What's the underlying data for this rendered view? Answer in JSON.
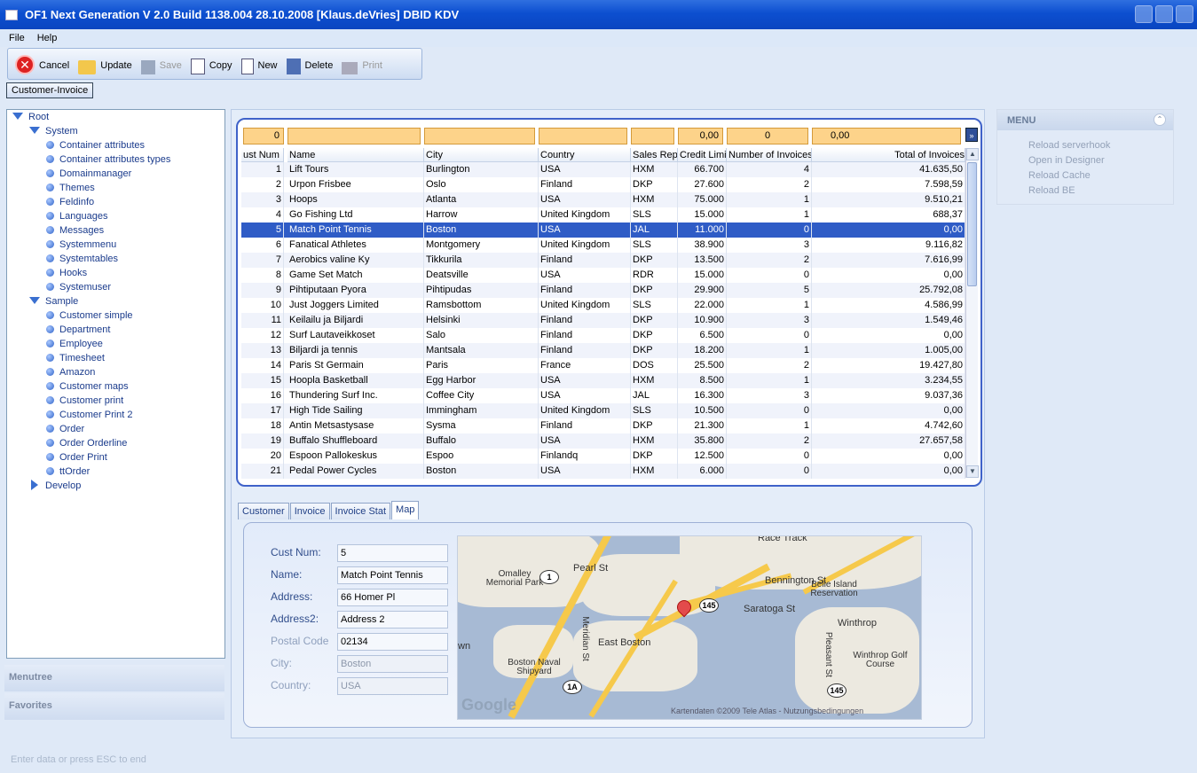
{
  "window": {
    "title": "OF1 Next Generation   V 2.0 Build 1138.004  28.10.2008   [Klaus.deVries]   DBID KDV"
  },
  "menubar": {
    "file": "File",
    "help": "Help"
  },
  "toolbar": {
    "cancel": "Cancel",
    "update": "Update",
    "save": "Save",
    "copy": "Copy",
    "new": "New",
    "delete": "Delete",
    "print": "Print"
  },
  "breadcrumb_tab": "Customer-Invoice",
  "tree": {
    "root": "Root",
    "system": "System",
    "system_items": [
      "Container attributes",
      "Container attributes types",
      "Domainmanager",
      "Themes",
      "Feldinfo",
      "Languages",
      "Messages",
      "Systemmenu",
      "Systemtables",
      "Hooks",
      "Systemuser"
    ],
    "sample": "Sample",
    "sample_items": [
      "Customer simple",
      "Department",
      "Employee",
      "Timesheet",
      "Amazon",
      "Customer maps",
      "Customer print",
      "Customer Print 2",
      "Order",
      "Order Orderline",
      "Order Print",
      "ttOrder"
    ],
    "develop": "Develop"
  },
  "sidebar": {
    "menutree": "Menutree",
    "favorites": "Favorites"
  },
  "status": "Enter data or press ESC to end",
  "grid": {
    "filters": {
      "cust": "0",
      "credit": "0,00",
      "invoices": "0",
      "total": "0,00"
    },
    "headers": [
      "ust Num",
      "Name",
      "City",
      "Country",
      "Sales Rep",
      "Credit Limit",
      "Number of Invoices",
      "Total of Invoices"
    ],
    "rows": [
      [
        "1",
        "Lift Tours",
        "Burlington",
        "USA",
        "HXM",
        "66.700",
        "4",
        "41.635,50"
      ],
      [
        "2",
        "Urpon Frisbee",
        "Oslo",
        "Finland",
        "DKP",
        "27.600",
        "2",
        "7.598,59"
      ],
      [
        "3",
        "Hoops",
        "Atlanta",
        "USA",
        "HXM",
        "75.000",
        "1",
        "9.510,21"
      ],
      [
        "4",
        "Go Fishing Ltd",
        "Harrow",
        "United Kingdom",
        "SLS",
        "15.000",
        "1",
        "688,37"
      ],
      [
        "5",
        "Match Point Tennis",
        "Boston",
        "USA",
        "JAL",
        "11.000",
        "0",
        "0,00"
      ],
      [
        "6",
        "Fanatical Athletes",
        "Montgomery",
        "United Kingdom",
        "SLS",
        "38.900",
        "3",
        "9.116,82"
      ],
      [
        "7",
        "Aerobics valine Ky",
        "Tikkurila",
        "Finland",
        "DKP",
        "13.500",
        "2",
        "7.616,99"
      ],
      [
        "8",
        "Game Set Match",
        "Deatsville",
        "USA",
        "RDR",
        "15.000",
        "0",
        "0,00"
      ],
      [
        "9",
        "Pihtiputaan Pyora",
        "Pihtipudas",
        "Finland",
        "DKP",
        "29.900",
        "5",
        "25.792,08"
      ],
      [
        "10",
        "Just Joggers Limited",
        "Ramsbottom",
        "United Kingdom",
        "SLS",
        "22.000",
        "1",
        "4.586,99"
      ],
      [
        "11",
        "Keilailu ja Biljardi",
        "Helsinki",
        "Finland",
        "DKP",
        "10.900",
        "3",
        "1.549,46"
      ],
      [
        "12",
        "Surf Lautaveikkoset",
        "Salo",
        "Finland",
        "DKP",
        "6.500",
        "0",
        "0,00"
      ],
      [
        "13",
        "Biljardi ja tennis",
        "Mantsala",
        "Finland",
        "DKP",
        "18.200",
        "1",
        "1.005,00"
      ],
      [
        "14",
        "Paris St Germain",
        "Paris",
        "France",
        "DOS",
        "25.500",
        "2",
        "19.427,80"
      ],
      [
        "15",
        "Hoopla Basketball",
        "Egg Harbor",
        "USA",
        "HXM",
        "8.500",
        "1",
        "3.234,55"
      ],
      [
        "16",
        "Thundering Surf Inc.",
        "Coffee City",
        "USA",
        "JAL",
        "16.300",
        "3",
        "9.037,36"
      ],
      [
        "17",
        "High Tide Sailing",
        "Immingham",
        "United Kingdom",
        "SLS",
        "10.500",
        "0",
        "0,00"
      ],
      [
        "18",
        "Antin Metsastysase",
        "Sysma",
        "Finland",
        "DKP",
        "21.300",
        "1",
        "4.742,60"
      ],
      [
        "19",
        "Buffalo Shuffleboard",
        "Buffalo",
        "USA",
        "HXM",
        "35.800",
        "2",
        "27.657,58"
      ],
      [
        "20",
        "Espoon Pallokeskus",
        "Espoo",
        "Finlandq",
        "DKP",
        "12.500",
        "0",
        "0,00"
      ],
      [
        "21",
        "Pedal Power Cycles",
        "Boston",
        "USA",
        "HXM",
        "6.000",
        "0",
        "0,00"
      ]
    ],
    "selected_index": 4
  },
  "tabs": [
    "Customer",
    "Invoice",
    "Invoice Stat",
    "Map"
  ],
  "detail": {
    "labels": {
      "cust": "Cust Num:",
      "name": "Name:",
      "address": "Address:",
      "address2": "Address2:",
      "postal": "Postal Code",
      "city": "City:",
      "country": "Country:"
    },
    "values": {
      "cust": "5",
      "name": "Match Point Tennis",
      "address": "66 Homer Pl",
      "address2": "Address 2",
      "postal": "02134",
      "city": "Boston",
      "country": "USA"
    }
  },
  "map": {
    "labels": [
      "Race Track",
      "Omalley Memorial Park",
      "Pearl St",
      "Bennington St",
      "Belle Island Reservation",
      "Saratoga St",
      "Winthrop",
      "East Boston",
      "Meridian St",
      "Boston Naval Shipyard",
      "Winthrop Golf Course",
      "Pleasant St",
      "wn"
    ],
    "shields": [
      "1",
      "145",
      "1A",
      "145"
    ],
    "watermark": "Google",
    "copyright": "Kartendaten ©2009 Tele Atlas - Nutzungsbedingungen"
  },
  "right_menu": {
    "title": "MENU",
    "items": [
      "Reload serverhook",
      "Open in Designer",
      "Reload Cache",
      "Reload BE"
    ]
  }
}
